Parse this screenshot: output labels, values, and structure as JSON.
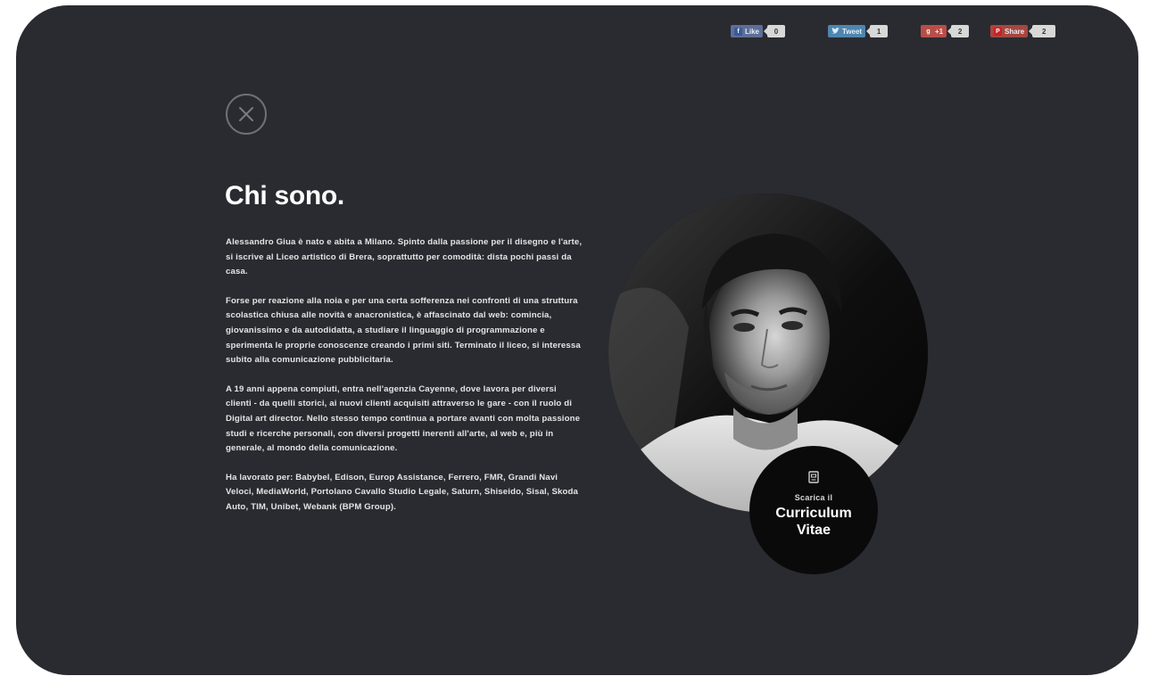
{
  "social": [
    {
      "id": "fb",
      "label": "Like",
      "count": "0",
      "icon": "facebook-icon",
      "color": "#3b5998"
    },
    {
      "id": "tw",
      "label": "Tweet",
      "count": "1",
      "icon": "twitter-icon",
      "color": "#4d86b0"
    },
    {
      "id": "gp",
      "label": "+1",
      "count": "2",
      "icon": "google-plus-icon",
      "color": "#b94e48"
    },
    {
      "id": "pn",
      "label": "Share",
      "count": "2",
      "icon": "pinterest-icon",
      "color": "#cb2027"
    }
  ],
  "page": {
    "title": "Chi sono.",
    "paragraphs": [
      "Alessandro Giua è nato e abita a Milano. Spinto dalla passione per il disegno e l'arte, si iscrive al Liceo artistico di Brera, soprattutto per comodità: dista pochi passi da casa.",
      "Forse per reazione alla noia e per una certa sofferenza nei confronti di una struttura scolastica chiusa alle novità e anacronistica, è affascinato dal web: comincia, giovanissimo e da autodidatta, a studiare il linguaggio di programmazione e sperimenta le proprie conoscenze creando i primi siti. Terminato il liceo, si interessa subito alla comunicazione pubblicitaria.",
      "A 19 anni appena compiuti, entra nell'agenzia Cayenne, dove lavora per diversi clienti - da quelli storici, ai nuovi clienti acquisiti attraverso le gare - con il ruolo di Digital art director. Nello stesso tempo continua a portare avanti con molta passione studi e ricerche personali, con diversi progetti inerenti all'arte, al web e, più in generale, al mondo della comunicazione.",
      "Ha lavorato per: Babybel, Edison, Europ Assistance, Ferrero, FMR, Grandi Navi Veloci, MediaWorld, Portolano Cavallo Studio Legale, Saturn, Shiseido, Sisal, Skoda Auto, TIM, Unibet, Webank (BPM Group)."
    ]
  },
  "cv": {
    "prefix": "Scarica il",
    "label": "Curriculum Vitae",
    "icon": "document-icon"
  },
  "colors": {
    "background": "#2a2b30",
    "text": "#ffffff",
    "cv_button": "#0a0a0b"
  }
}
